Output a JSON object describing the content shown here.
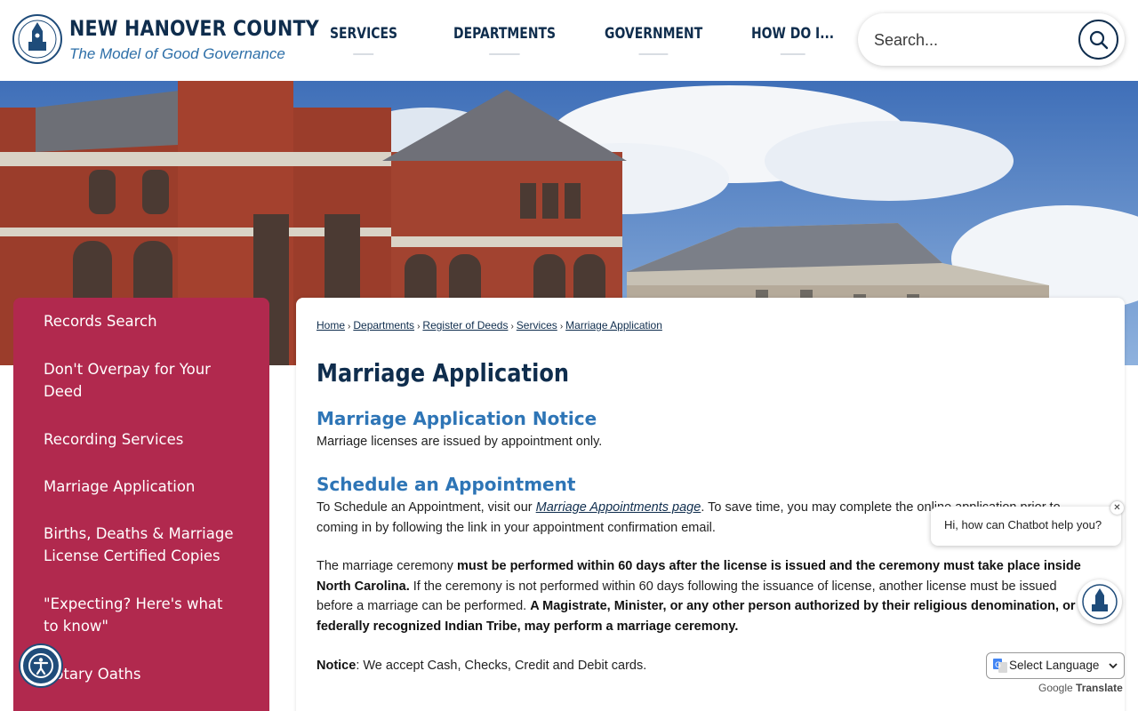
{
  "header": {
    "org_name": "NEW HANOVER COUNTY",
    "tagline": "The Model of Good Governance",
    "nav": [
      {
        "label": "SERVICES"
      },
      {
        "label": "DEPARTMENTS"
      },
      {
        "label": "GOVERNMENT"
      },
      {
        "label": "HOW DO I..."
      }
    ],
    "search": {
      "placeholder": "Search..."
    }
  },
  "sidebar": {
    "items": [
      {
        "label": "Records Search"
      },
      {
        "label": "Don't Overpay for Your Deed"
      },
      {
        "label": "Recording Services"
      },
      {
        "label": "Marriage Application"
      },
      {
        "label": "Births, Deaths & Marriage License Certified Copies"
      },
      {
        "label": "\"Expecting?  Here's what to know\""
      },
      {
        "label": "Notary Oaths"
      }
    ]
  },
  "breadcrumb": {
    "items": [
      "Home",
      "Departments",
      "Register of Deeds",
      "Services",
      "Marriage Application"
    ],
    "separator": "›"
  },
  "content": {
    "title": "Marriage Application",
    "notice_heading": "Marriage Application Notice",
    "notice_text": "Marriage licenses are issued by appointment only.",
    "schedule_heading": "Schedule an Appointment",
    "schedule_pre": "To Schedule an Appointment, visit our ",
    "schedule_link": "Marriage Appointments page",
    "schedule_post": ". To save time, you may complete the online application prior to coming in by following the link in your appointment confirmation email.",
    "ceremony_1": "The marriage ceremony ",
    "ceremony_2": "must be performed within 60 days after the license is issued and the ceremony must take place inside North Carolina.",
    "ceremony_3": " If the ceremony is not performed within 60 days following the issuance of license, another license must be issued before a marriage can be performed. ",
    "ceremony_4": "A Magistrate, Minister, or any other person authorized by their religious denomination, or federally recognized Indian Tribe, may perform a marriage ceremony.",
    "payment_label": "Notice",
    "payment_text": ": We accept Cash, Checks, Credit and Debit cards."
  },
  "chatbot": {
    "greeting": "Hi, how can Chatbot help you?",
    "close_glyph": "✕"
  },
  "translate": {
    "select_label": "Select Language",
    "powered_by": "Google",
    "translate_word": "Translate"
  },
  "colors": {
    "navy": "#0f2d4d",
    "accent_blue": "#2e75b6",
    "sidebar_red": "#b1294e"
  }
}
